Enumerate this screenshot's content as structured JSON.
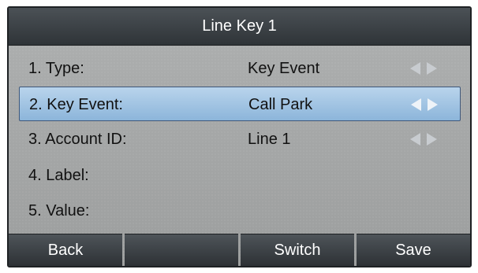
{
  "title": "Line Key 1",
  "rows": [
    {
      "label": "1. Type:",
      "value": "Key Event",
      "arrows": true
    },
    {
      "label": "2. Key Event:",
      "value": "Call Park",
      "arrows": true,
      "selected": true
    },
    {
      "label": "3. Account ID:",
      "value": "Line 1",
      "arrows": true
    },
    {
      "label": "4. Label:",
      "value": ""
    },
    {
      "label": "5. Value:",
      "value": ""
    }
  ],
  "softkeys": [
    "Back",
    "",
    "Switch",
    "Save"
  ],
  "colors": {
    "title_bg": "#3b4146",
    "selected_row": "#a9c9e6",
    "screen_bg": "#a6a8a8"
  },
  "icons": {
    "left": "left-arrow-icon",
    "right": "right-arrow-icon"
  }
}
